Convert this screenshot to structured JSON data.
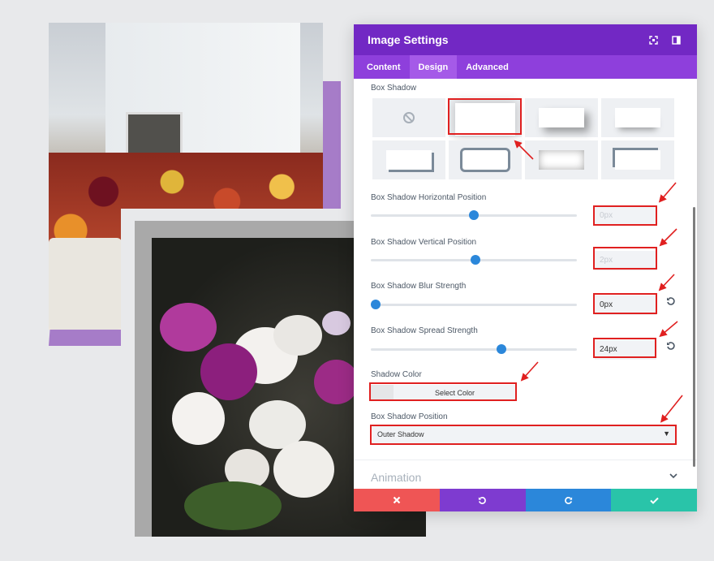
{
  "panel": {
    "title": "Image Settings",
    "tabs": [
      {
        "label": "Content",
        "active": false
      },
      {
        "label": "Design",
        "active": true
      },
      {
        "label": "Advanced",
        "active": false
      }
    ]
  },
  "box_shadow": {
    "label": "Box Shadow",
    "selected_preset": 2
  },
  "fields": {
    "horizontal": {
      "label": "Box Shadow Horizontal Position",
      "value": "0px",
      "slider_level": 0.5
    },
    "vertical": {
      "label": "Box Shadow Vertical Position",
      "value": "2px",
      "slider_level": 0.51
    },
    "blur": {
      "label": "Box Shadow Blur Strength",
      "value": "0px",
      "slider_level": 0.0
    },
    "spread": {
      "label": "Box Shadow Spread Strength",
      "value": "24px",
      "slider_level": 0.64
    }
  },
  "shadow_color": {
    "label": "Shadow Color",
    "button": "Select Color"
  },
  "position": {
    "label": "Box Shadow Position",
    "value": "Outer Shadow"
  },
  "animation": {
    "label": "Animation"
  },
  "colors": {
    "header": "#7228c4",
    "tabs": "#8e3fdc",
    "cancel": "#ef5555",
    "undo": "#7e3bd0",
    "redo": "#2b87da",
    "save": "#29c4a9",
    "highlight": "#e02020"
  },
  "icons": {
    "expand": "expand-icon",
    "sidebar": "sidebar-icon",
    "cancel": "close-icon",
    "undo": "undo-icon",
    "redo": "redo-icon",
    "save": "check-icon",
    "reset": "reset-icon",
    "chevron": "chevron-down-icon"
  }
}
